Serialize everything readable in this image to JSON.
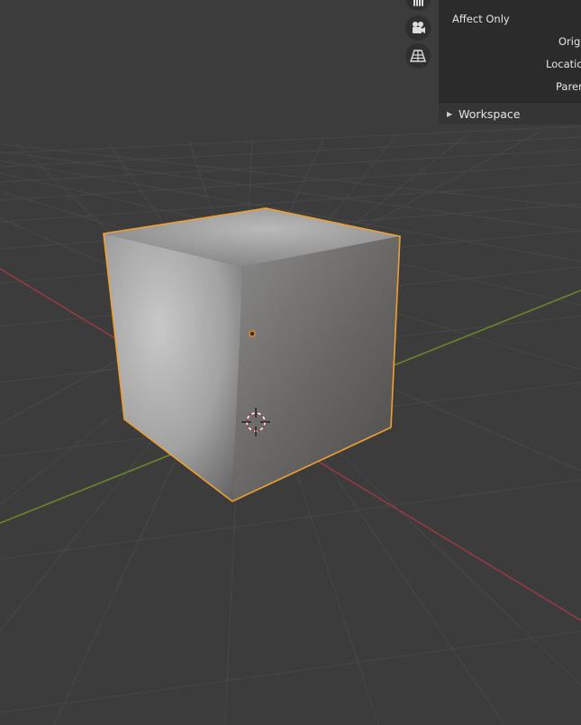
{
  "properties_panel": {
    "affect_only_label": "Affect Only",
    "origins_label": "Origins",
    "locations_label": "Locations",
    "parents_label": "Parents"
  },
  "workspace_panel": {
    "title": "Workspace",
    "collapsed": true
  },
  "navigation_gizmo": {
    "icons": [
      "hand-pan-icon",
      "camera-icon",
      "perspective-grid-icon"
    ]
  },
  "colors": {
    "background": "#3c3c3c",
    "grid_line": "#4a4a4a",
    "x_axis": "#9b3a44",
    "y_axis": "#6b8a2a",
    "selection_outline": "#f0a030",
    "object_origin": "#f09020",
    "panel_bg": "#2b2b2b"
  }
}
